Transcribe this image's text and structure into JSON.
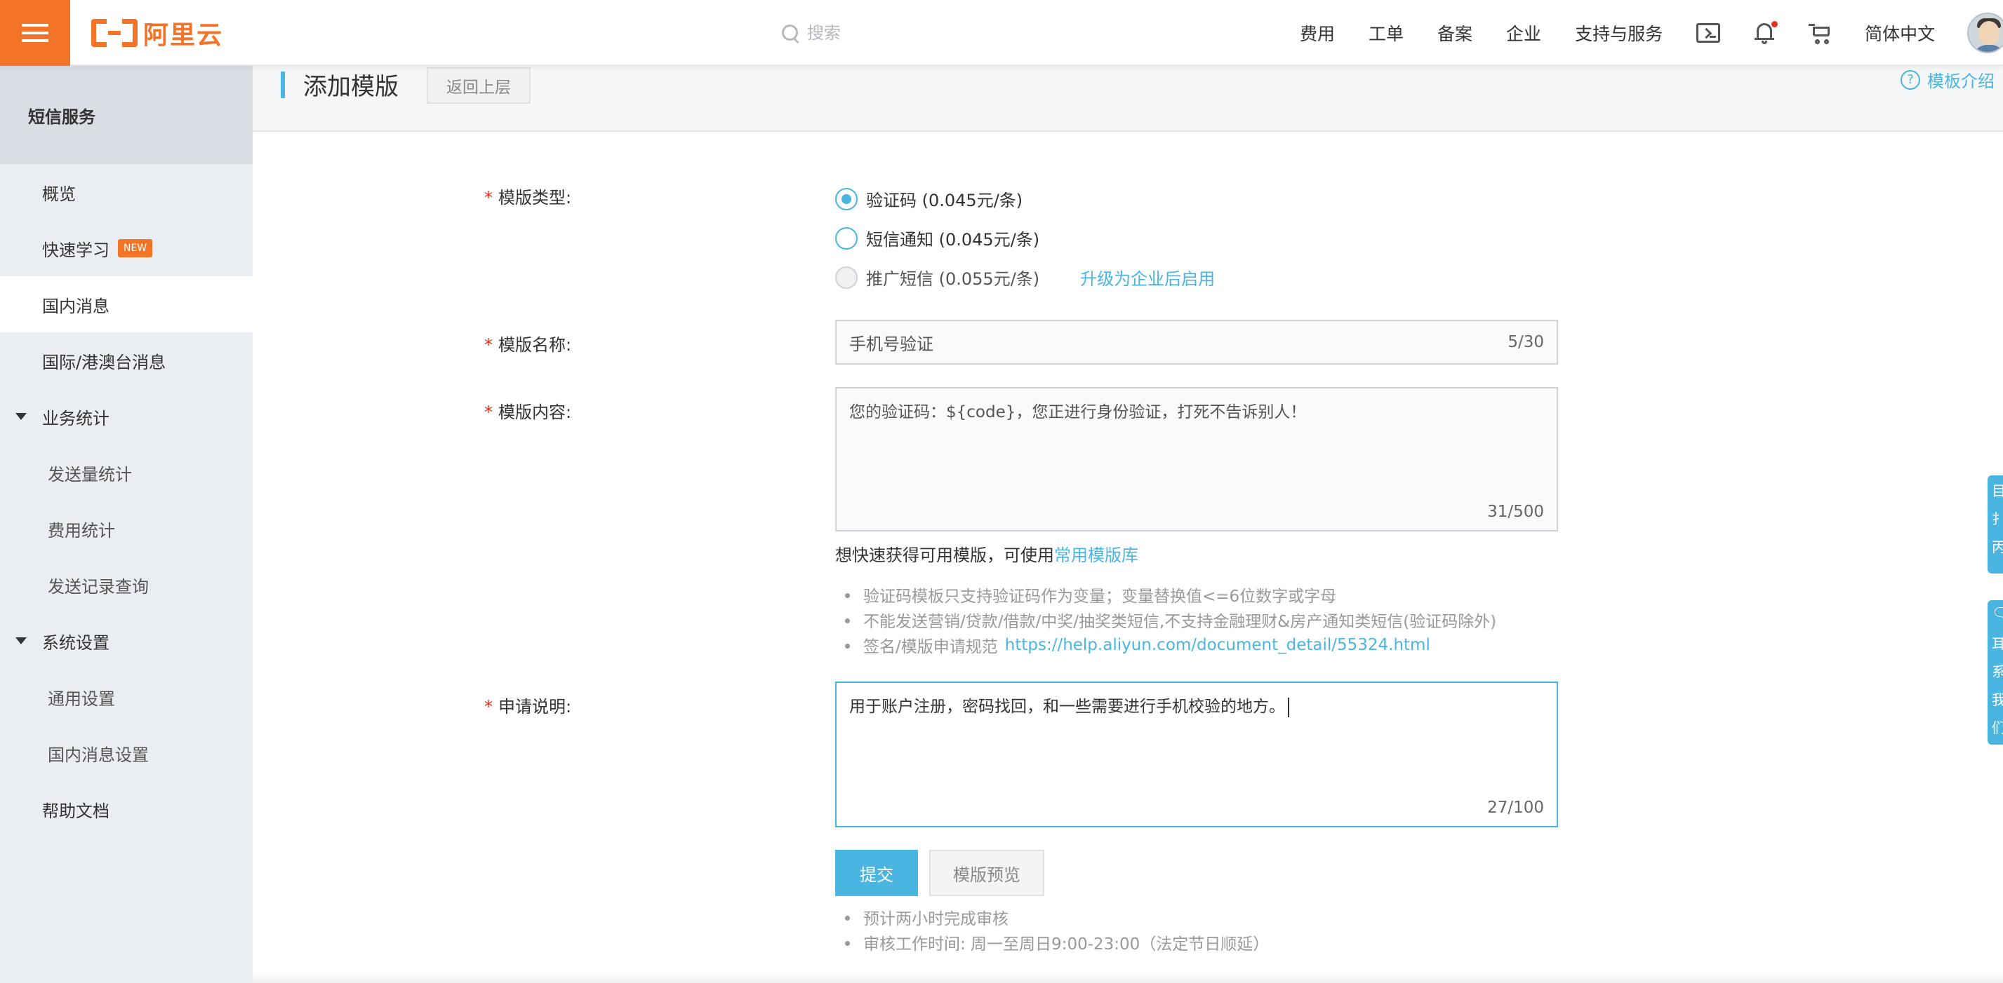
{
  "header": {
    "logo_text": "阿里云",
    "search_placeholder": "搜索",
    "nav_links": [
      "费用",
      "工单",
      "备案",
      "企业",
      "支持与服务"
    ],
    "language": "简体中文",
    "icons": [
      "menu-icon",
      "search-icon",
      "terminal-icon",
      "bell-icon",
      "cart-icon",
      "avatar"
    ],
    "brand_color": "#f37327"
  },
  "sidebar": {
    "title": "短信服务",
    "items": [
      {
        "label": "概览"
      },
      {
        "label": "快速学习",
        "badge": "NEW"
      },
      {
        "label": "国内消息",
        "active": true
      },
      {
        "label": "国际/港澳台消息"
      },
      {
        "label": "业务统计",
        "expandable": true
      },
      {
        "label": "发送量统计",
        "sub": true
      },
      {
        "label": "费用统计",
        "sub": true
      },
      {
        "label": "发送记录查询",
        "sub": true
      },
      {
        "label": "系统设置",
        "expandable": true
      },
      {
        "label": "通用设置",
        "sub": true
      },
      {
        "label": "国内消息设置",
        "sub": true
      },
      {
        "label": "帮助文档"
      }
    ]
  },
  "page": {
    "title": "添加模版",
    "back_label": "返回上层",
    "help_label": "模板介绍",
    "accent_color": "#4ab5e0"
  },
  "form": {
    "required_mark": "*",
    "type_label": "模版类型:",
    "type_options": [
      {
        "label": "验证码 (0.045元/条)",
        "checked": true
      },
      {
        "label": "短信通知 (0.045元/条)",
        "checked": false
      },
      {
        "label": "推广短信 (0.055元/条)",
        "disabled": true
      }
    ],
    "upgrade_link": "升级为企业后启用",
    "name_label": "模版名称:",
    "name_value": "手机号验证",
    "name_counter": "5/30",
    "content_label": "模版内容:",
    "content_value": "您的验证码：${code}，您正进行身份验证，打死不告诉别人！",
    "content_counter": "31/500",
    "quick_hint": "想快速获得可用模版，可使用",
    "quick_hint_link": "常用模版库",
    "rules": [
      "验证码模板只支持验证码作为变量；变量替换值<=6位数字或字母",
      "不能发送营销/贷款/借款/中奖/抽奖类短信,不支持金融理财&房产通知类短信(验证码除外)",
      "签名/模版申请规范"
    ],
    "rules_link": "https://help.aliyun.com/document_detail/55324.html",
    "desc_label": "申请说明:",
    "desc_value": "用于账户注册，密码找回，和一些需要进行手机校验的地方。",
    "desc_counter": "27/100",
    "submit_label": "提交",
    "preview_label": "模版预览",
    "notes": [
      "预计两小时完成审核",
      "审核工作时间: 周一至周日9:00-23:00（法定节日顺延）"
    ]
  },
  "float_tabs": [
    {
      "chars": [
        "目",
        "扌",
        "丙"
      ]
    },
    {
      "chars": [
        "🗨",
        "耳",
        "系",
        "我",
        "们"
      ]
    }
  ]
}
